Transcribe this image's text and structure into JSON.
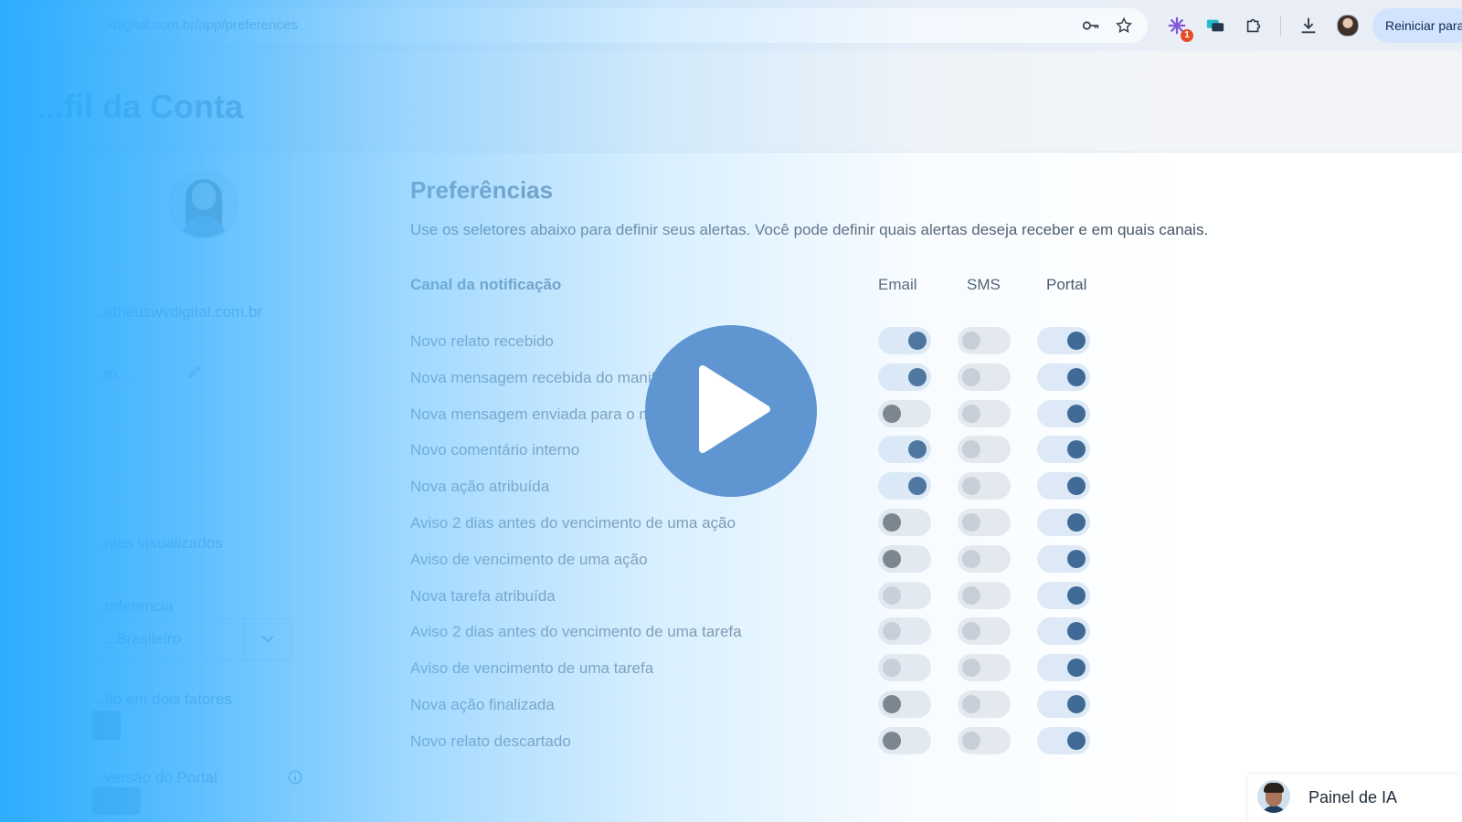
{
  "browser": {
    "url": "...vdigital.com.br/app/preferences",
    "icons": [
      "key-icon",
      "star-icon",
      "extension-colorful-icon",
      "chat-extension-icon",
      "puzzle-icon",
      "download-icon",
      "profile-avatar-icon"
    ],
    "extension_badge": "1",
    "restart_label": "Reiniciar para"
  },
  "page": {
    "title": "...fil da Conta"
  },
  "profile": {
    "email": "...atheuswvdigital.com.br",
    "field_edit": "...m...",
    "notifications_link": "...ntes visualizados",
    "language_label": "...referencia",
    "language_value": "...Brasileiro",
    "twofa_label": "...ão em dois fatores",
    "portal_version_label": "...versão do Portal"
  },
  "preferences": {
    "title": "Preferências",
    "description": "Use os seletores abaixo para definir seus alertas. Você pode definir quais alertas deseja receber e em quais canais.",
    "columns": {
      "channel": "Canal da notificação",
      "email": "Email",
      "sms": "SMS",
      "portal": "Portal"
    },
    "rows": [
      {
        "label": "Novo relato recebido",
        "email": true,
        "sms": false,
        "portal": true,
        "email_dark": false
      },
      {
        "label": "Nova mensagem recebida do manifestante",
        "email": true,
        "sms": false,
        "portal": true,
        "email_dark": false
      },
      {
        "label": "Nova mensagem enviada para o manifestante",
        "email": false,
        "sms": false,
        "portal": true,
        "email_dark": true
      },
      {
        "label": "Novo comentário interno",
        "email": true,
        "sms": false,
        "portal": true,
        "email_dark": false
      },
      {
        "label": "Nova ação atribuída",
        "email": true,
        "sms": false,
        "portal": true,
        "email_dark": false
      },
      {
        "label": "Aviso 2 dias antes do vencimento de uma ação",
        "email": false,
        "sms": false,
        "portal": true,
        "email_dark": true
      },
      {
        "label": "Aviso de vencimento de uma ação",
        "email": false,
        "sms": false,
        "portal": true,
        "email_dark": true
      },
      {
        "label": "Nova tarefa atribuída",
        "email": false,
        "sms": false,
        "portal": true,
        "email_dark": false
      },
      {
        "label": "Aviso 2 dias antes do vencimento de uma tarefa",
        "email": false,
        "sms": false,
        "portal": true,
        "email_dark": false
      },
      {
        "label": "Aviso de vencimento de uma tarefa",
        "email": false,
        "sms": false,
        "portal": true,
        "email_dark": false
      },
      {
        "label": "Nova ação finalizada",
        "email": false,
        "sms": false,
        "portal": true,
        "email_dark": true
      },
      {
        "label": "Novo relato descartado",
        "email": false,
        "sms": false,
        "portal": true,
        "email_dark": true
      }
    ]
  },
  "overlay": {
    "play_icon": "play-icon",
    "gradient_start": "#29abff",
    "play_color": "#5f96d2"
  },
  "ai_panel": {
    "label": "Painel de IA"
  },
  "colors": {
    "toggle_on_knob": "#2e5b8a",
    "toggle_on_track": "#dde8f5",
    "toggle_off_track": "#e5e8ec"
  }
}
